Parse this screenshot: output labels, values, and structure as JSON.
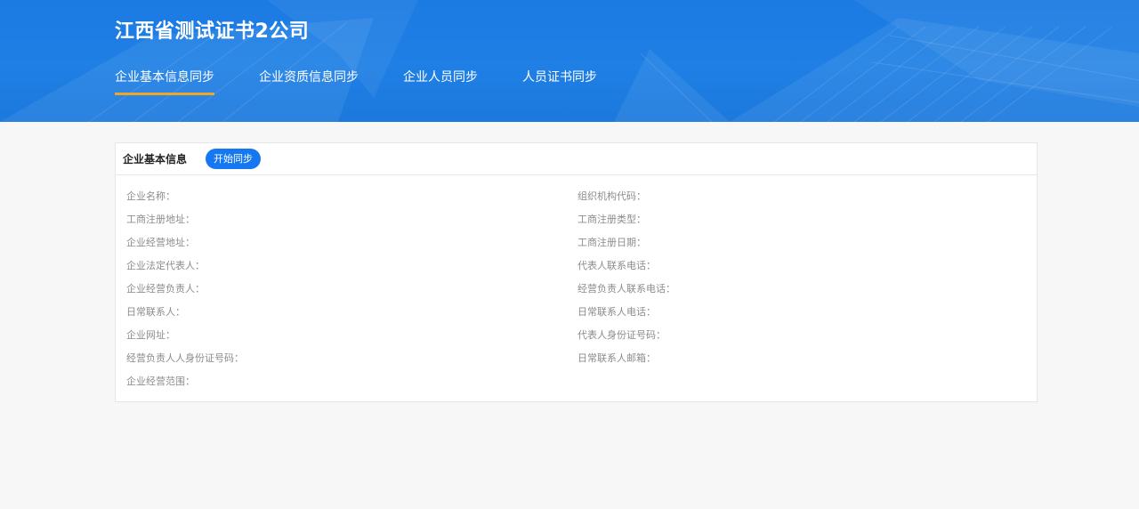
{
  "header": {
    "title": "江西省测试证书2公司",
    "tabs": [
      {
        "label": "企业基本信息同步",
        "active": true
      },
      {
        "label": "企业资质信息同步",
        "active": false
      },
      {
        "label": "企业人员同步",
        "active": false
      },
      {
        "label": "人员证书同步",
        "active": false
      }
    ],
    "accent_color": "#f0a526",
    "bg_color": "#1b7be3"
  },
  "panel": {
    "title": "企业基本信息",
    "sync_button": "开始同步",
    "fields": [
      {
        "left": "企业名称：",
        "right": "组织机构代码："
      },
      {
        "left": "工商注册地址：",
        "right": "工商注册类型："
      },
      {
        "left": "企业经营地址：",
        "right": "工商注册日期："
      },
      {
        "left": "企业法定代表人：",
        "right": "代表人联系电话："
      },
      {
        "left": "企业经营负责人：",
        "right": "经营负责人联系电话："
      },
      {
        "left": "日常联系人：",
        "right": "日常联系人电话："
      },
      {
        "left": "企业网址：",
        "right": "代表人身份证号码："
      },
      {
        "left": "经营负责人人身份证号码：",
        "right": "日常联系人邮箱："
      },
      {
        "left": "企业经营范围：",
        "right": ""
      }
    ]
  }
}
